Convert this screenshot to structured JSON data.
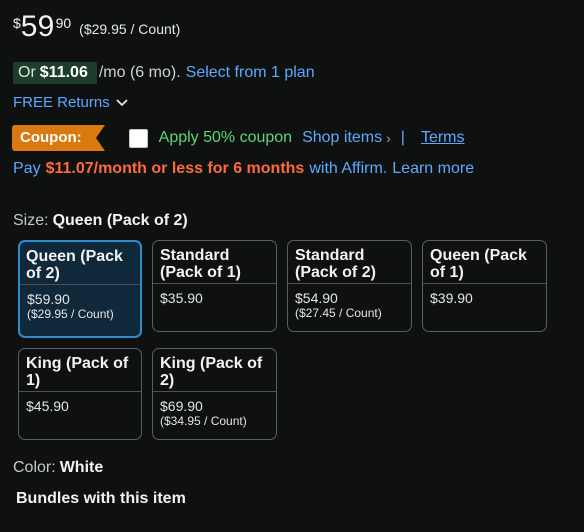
{
  "price": {
    "currency_symbol": "$",
    "whole": "59",
    "fraction": "90",
    "unit_price": "($29.95 / Count)"
  },
  "monthly": {
    "prefix": "Or",
    "amount": "$11.06",
    "term": "/mo (6 mo).",
    "link": "Select from 1 plan"
  },
  "returns": {
    "label": "FREE Returns"
  },
  "coupon": {
    "badge": "Coupon:",
    "apply_label": "Apply 50% coupon",
    "shop_items": "Shop items",
    "shop_chevron": "›",
    "separator": "|",
    "terms": "Terms"
  },
  "affirm": {
    "pay": "Pay",
    "amount": "$11.07/month or less for 6 months",
    "with": "with Affirm.",
    "learn_more": "Learn more"
  },
  "size": {
    "label": "Size:",
    "selected": "Queen (Pack of 2)",
    "options": [
      {
        "name": "Queen (Pack of 2)",
        "price": "$59.90",
        "unit": "($29.95 / Count)",
        "selected": true
      },
      {
        "name": "Standard (Pack of 1)",
        "price": "$35.90",
        "unit": "",
        "selected": false
      },
      {
        "name": "Standard (Pack of 2)",
        "price": "$54.90",
        "unit": "($27.45 / Count)",
        "selected": false
      },
      {
        "name": "Queen (Pack of 1)",
        "price": "$39.90",
        "unit": "",
        "selected": false
      },
      {
        "name": "King (Pack of 1)",
        "price": "$45.90",
        "unit": "",
        "selected": false
      },
      {
        "name": "King (Pack of 2)",
        "price": "$69.90",
        "unit": "($34.95 / Count)",
        "selected": false
      }
    ]
  },
  "color": {
    "label": "Color:",
    "value": "White"
  },
  "bundles": {
    "title": "Bundles with this item"
  },
  "colors": {
    "background": "#0f1111",
    "link": "#5fa8ff",
    "coupon_badge": "#d9790f",
    "coupon_apply": "#5fd47a",
    "affirm_amount": "#ff6a3d",
    "selected_border": "#2f8ccf",
    "monthly_pill": "#1e3d2b"
  }
}
